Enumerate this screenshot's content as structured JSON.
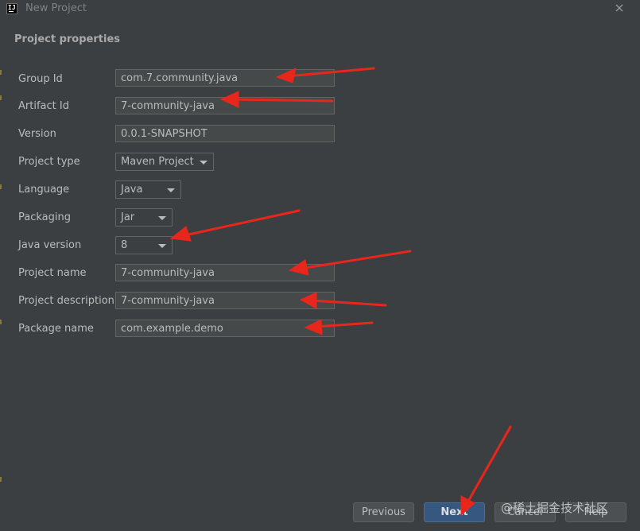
{
  "window": {
    "title": "New Project",
    "logo_text": "IJ"
  },
  "section_title": "Project properties",
  "fields": {
    "group_id": {
      "label": "Group Id",
      "value": "com.7.community.java"
    },
    "artifact_id": {
      "label": "Artifact Id",
      "value": "7-community-java"
    },
    "version": {
      "label": "Version",
      "value": "0.0.1-SNAPSHOT"
    },
    "project_type": {
      "label": "Project type",
      "value": "Maven Project"
    },
    "language": {
      "label": "Language",
      "value": "Java"
    },
    "packaging": {
      "label": "Packaging",
      "value": "Jar"
    },
    "java_version": {
      "label": "Java version",
      "value": "8"
    },
    "project_name": {
      "label": "Project name",
      "value": "7-community-java"
    },
    "project_description": {
      "label": "Project description",
      "value": "7-community-java"
    },
    "package_name": {
      "label": "Package name",
      "value": "com.example.demo"
    }
  },
  "buttons": {
    "previous": "Previous",
    "next": "Next",
    "cancel": "Cancel",
    "help": "Help"
  },
  "watermark": "@稀土掘金技术社区",
  "colors": {
    "background": "#3c3f41",
    "field_bg": "#45494a",
    "primary_button": "#365880",
    "annotation_arrow": "#e8261c"
  }
}
